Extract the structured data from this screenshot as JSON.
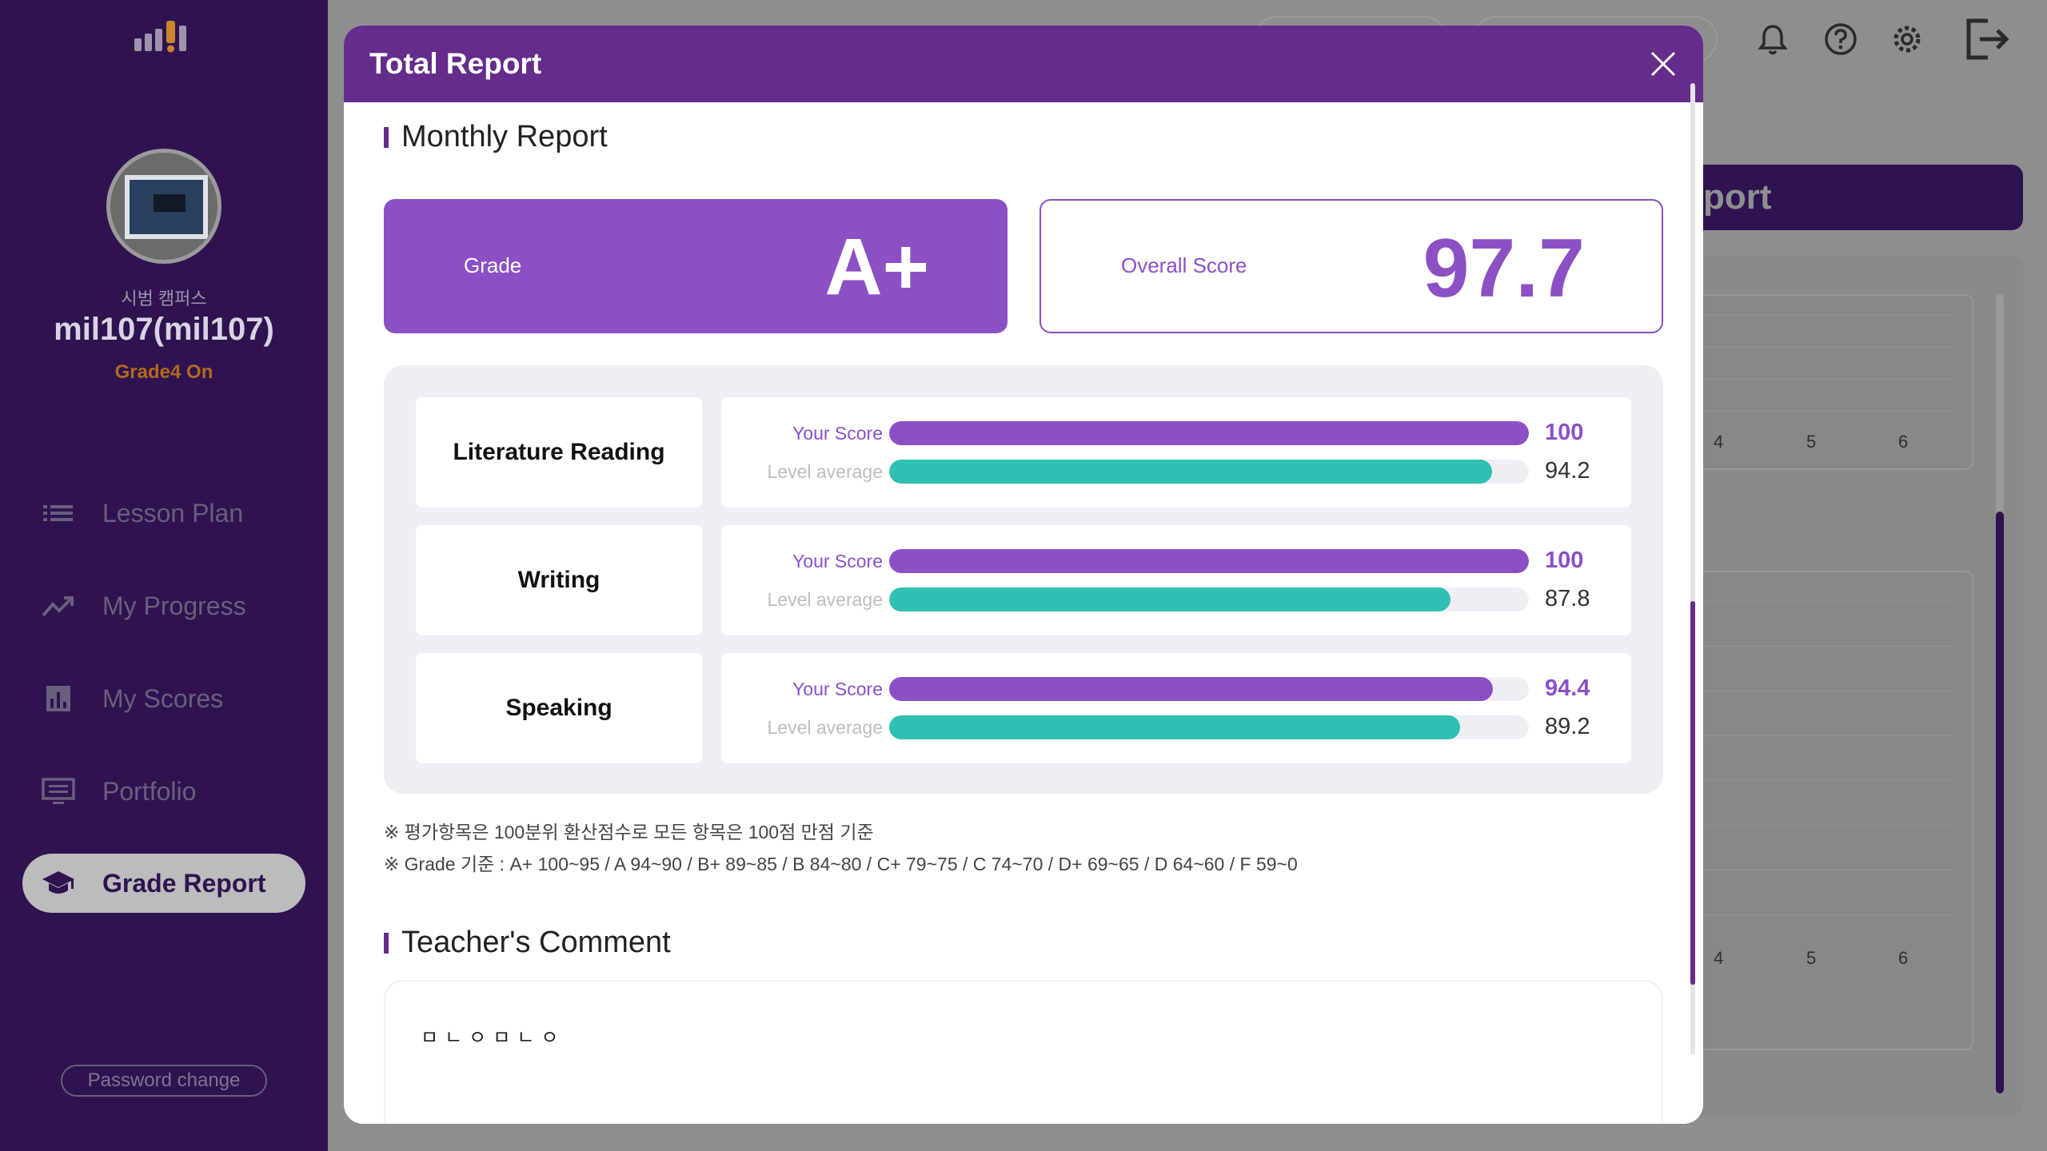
{
  "sidebar": {
    "campus": "시범 캠퍼스",
    "user_name": "mil107(mil107)",
    "grade_status": "Grade4 On",
    "nav": [
      {
        "label": "Lesson Plan",
        "icon": "list-icon"
      },
      {
        "label": "My Progress",
        "icon": "trend-icon"
      },
      {
        "label": "My Scores",
        "icon": "bar-chart-icon"
      },
      {
        "label": "Portfolio",
        "icon": "monitor-icon"
      },
      {
        "label": "Grade Report",
        "icon": "graduation-cap-icon"
      }
    ],
    "active_item": "Grade Report",
    "password_change": "Password change"
  },
  "background": {
    "banner_text": "port",
    "chart_ticks_top": [
      "4",
      "5",
      "6"
    ],
    "chart_ticks_bottom": [
      "4",
      "5",
      "6"
    ]
  },
  "modal": {
    "title": "Total Report",
    "monthly_title": "Monthly Report",
    "grade_label": "Grade",
    "grade_value": "A+",
    "overall_label": "Overall Score",
    "overall_value": "97.7",
    "your_score_label": "Your Score",
    "level_average_label": "Level average",
    "subjects": [
      {
        "name": "Literature Reading",
        "your_score": "100",
        "level_average": "94.2",
        "your_frac": 1.0,
        "avg_frac": 0.942
      },
      {
        "name": "Writing",
        "your_score": "100",
        "level_average": "87.8",
        "your_frac": 1.0,
        "avg_frac": 0.878
      },
      {
        "name": "Speaking",
        "your_score": "94.4",
        "level_average": "89.2",
        "your_frac": 0.944,
        "avg_frac": 0.892
      }
    ],
    "note_1": "※ 평가항목은 100분위 환산점수로 모든 항목은 100점 만점 기준",
    "note_2": "※ Grade 기준 : A+ 100~95 / A 94~90 / B+ 89~85 / B 84~80 / C+ 79~75 / C 74~70 / D+ 69~65 / D 64~60 / F 59~0",
    "comment_title": "Teacher's Comment",
    "comment_text": "ㅁㄴㅇㅁㄴㅇ"
  },
  "colors": {
    "header": "#652c8b",
    "accent": "#8c50c4",
    "teal": "#2fbfb3",
    "sidebar": "#2f1350"
  }
}
